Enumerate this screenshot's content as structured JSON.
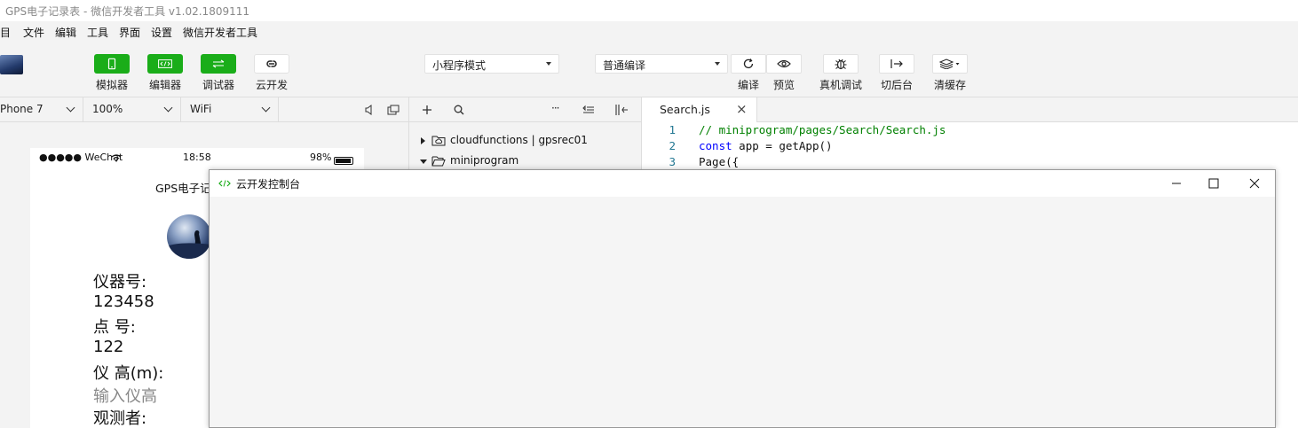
{
  "window": {
    "title": "GPS电子记录表 - 微信开发者工具 v1.02.1809111"
  },
  "menu": [
    "目",
    "文件",
    "编辑",
    "工具",
    "界面",
    "设置",
    "微信开发者工具"
  ],
  "toolbar": {
    "left_buttons": [
      {
        "label": "模拟器",
        "icon": "phone-icon"
      },
      {
        "label": "编辑器",
        "icon": "code-icon"
      },
      {
        "label": "调试器",
        "icon": "debug-switch-icon"
      },
      {
        "label": "云开发",
        "icon": "cloud-link-icon"
      }
    ],
    "mode_select": "小程序模式",
    "compile_select": "普通编译",
    "right_buttons": [
      {
        "label": "编译",
        "icon": "refresh-icon"
      },
      {
        "label": "预览",
        "icon": "eye-icon"
      },
      {
        "label": "真机调试",
        "icon": "bug-icon"
      },
      {
        "label": "切后台",
        "icon": "switch-bg-icon"
      },
      {
        "label": "清缓存",
        "icon": "layers-icon"
      }
    ],
    "accent": "#1aad19"
  },
  "simulator": {
    "device": "Phone 7",
    "zoom": "100%",
    "network": "WiFi",
    "status_carrier": "●●●●● WeChat",
    "status_time": "18:58",
    "status_battery": "98%",
    "page_title": "GPS电子记",
    "form": [
      {
        "text": "仪器号:",
        "placeholder": false
      },
      {
        "text": "123458",
        "placeholder": false
      },
      {
        "text": "点 号:",
        "placeholder": false
      },
      {
        "text": "122",
        "placeholder": false
      },
      {
        "text": "仪 高(m):",
        "placeholder": false
      },
      {
        "text": "输入仪高",
        "placeholder": true
      },
      {
        "text": "观测者:",
        "placeholder": false
      }
    ]
  },
  "tree": {
    "toolbar_more": "···",
    "nodes": [
      {
        "label": "cloudfunctions | gpsrec01",
        "expanded": false
      },
      {
        "label": "miniprogram",
        "expanded": true
      }
    ]
  },
  "editor": {
    "tab_label": "Search.js",
    "tab_close": "×",
    "lines": [
      {
        "num": "1",
        "text": "// miniprogram/pages/Search/Search.js",
        "kind": "comment"
      },
      {
        "num": "2",
        "kw": "const",
        "text": " app = getApp()",
        "kind": "code"
      },
      {
        "num": "3",
        "text": "Page({",
        "kind": "plain"
      }
    ]
  },
  "dialog": {
    "title": "云开发控制台"
  }
}
